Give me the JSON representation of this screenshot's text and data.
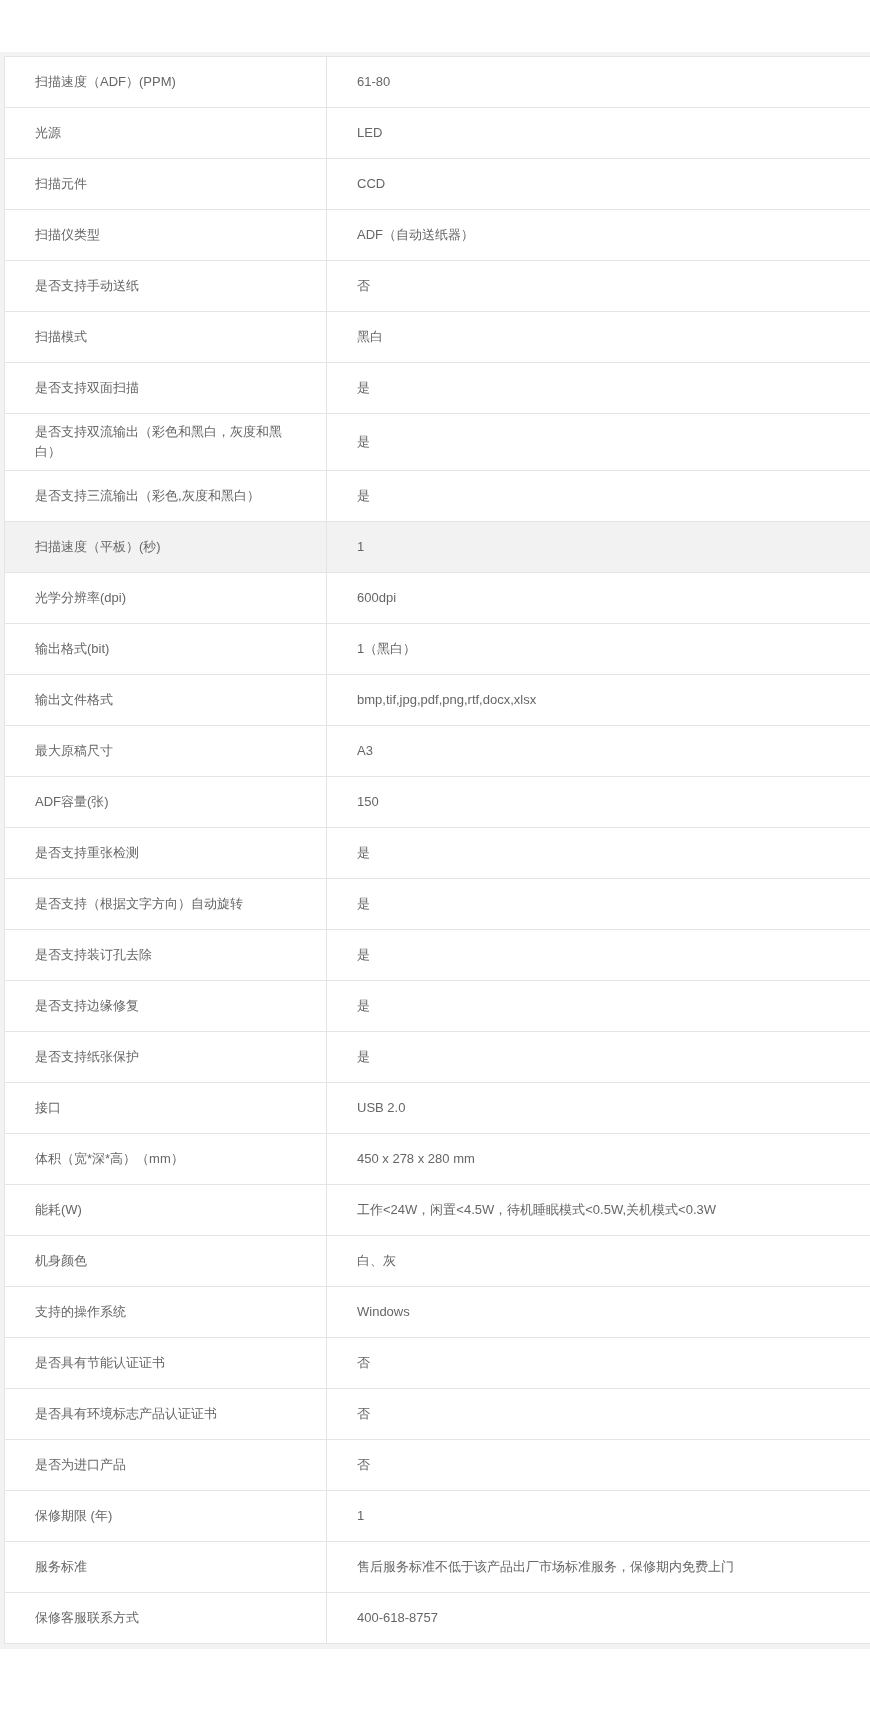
{
  "rows": [
    {
      "label": "扫描速度（ADF）(PPM)",
      "value": "61-80",
      "highlighted": false
    },
    {
      "label": "光源",
      "value": "LED",
      "highlighted": false
    },
    {
      "label": "扫描元件",
      "value": "CCD",
      "highlighted": false
    },
    {
      "label": "扫描仪类型",
      "value": "ADF（自动送纸器）",
      "highlighted": false
    },
    {
      "label": "是否支持手动送纸",
      "value": "否",
      "highlighted": false
    },
    {
      "label": "扫描模式",
      "value": "黑白",
      "highlighted": false
    },
    {
      "label": "是否支持双面扫描",
      "value": "是",
      "highlighted": false
    },
    {
      "label": "是否支持双流输出（彩色和黑白，灰度和黑白）",
      "value": "是",
      "highlighted": false
    },
    {
      "label": "是否支持三流输出（彩色,灰度和黑白）",
      "value": "是",
      "highlighted": false
    },
    {
      "label": "扫描速度（平板）(秒)",
      "value": "1",
      "highlighted": true
    },
    {
      "label": "光学分辨率(dpi)",
      "value": "600dpi",
      "highlighted": false
    },
    {
      "label": "输出格式(bit)",
      "value": "1（黑白）",
      "highlighted": false
    },
    {
      "label": "输出文件格式",
      "value": "bmp,tif,jpg,pdf,png,rtf,docx,xlsx",
      "highlighted": false
    },
    {
      "label": "最大原稿尺寸",
      "value": "A3",
      "highlighted": false
    },
    {
      "label": "ADF容量(张)",
      "value": "150",
      "highlighted": false
    },
    {
      "label": "是否支持重张检测",
      "value": "是",
      "highlighted": false
    },
    {
      "label": "是否支持（根据文字方向）自动旋转",
      "value": "是",
      "highlighted": false
    },
    {
      "label": "是否支持装订孔去除",
      "value": "是",
      "highlighted": false
    },
    {
      "label": "是否支持边缘修复",
      "value": "是",
      "highlighted": false
    },
    {
      "label": "是否支持纸张保护",
      "value": "是",
      "highlighted": false
    },
    {
      "label": "接口",
      "value": "USB 2.0",
      "highlighted": false
    },
    {
      "label": "体积（宽*深*高）（mm）",
      "value": "450 x 278 x 280 mm",
      "highlighted": false
    },
    {
      "label": "能耗(W)",
      "value": "工作<24W，闲置<4.5W，待机睡眠模式<0.5W,关机模式<0.3W",
      "highlighted": false
    },
    {
      "label": "机身颜色",
      "value": "白、灰",
      "highlighted": false
    },
    {
      "label": "支持的操作系统",
      "value": "Windows",
      "highlighted": false
    },
    {
      "label": "是否具有节能认证证书",
      "value": "否",
      "highlighted": false
    },
    {
      "label": "是否具有环境标志产品认证证书",
      "value": "否",
      "highlighted": false
    },
    {
      "label": "是否为进口产品",
      "value": "否",
      "highlighted": false
    },
    {
      "label": "保修期限 (年)",
      "value": "1",
      "highlighted": false
    },
    {
      "label": "服务标准",
      "value": "售后服务标准不低于该产品出厂市场标准服务，保修期内免费上门",
      "highlighted": false
    },
    {
      "label": "保修客服联系方式",
      "value": "400-618-8757",
      "highlighted": false
    }
  ]
}
